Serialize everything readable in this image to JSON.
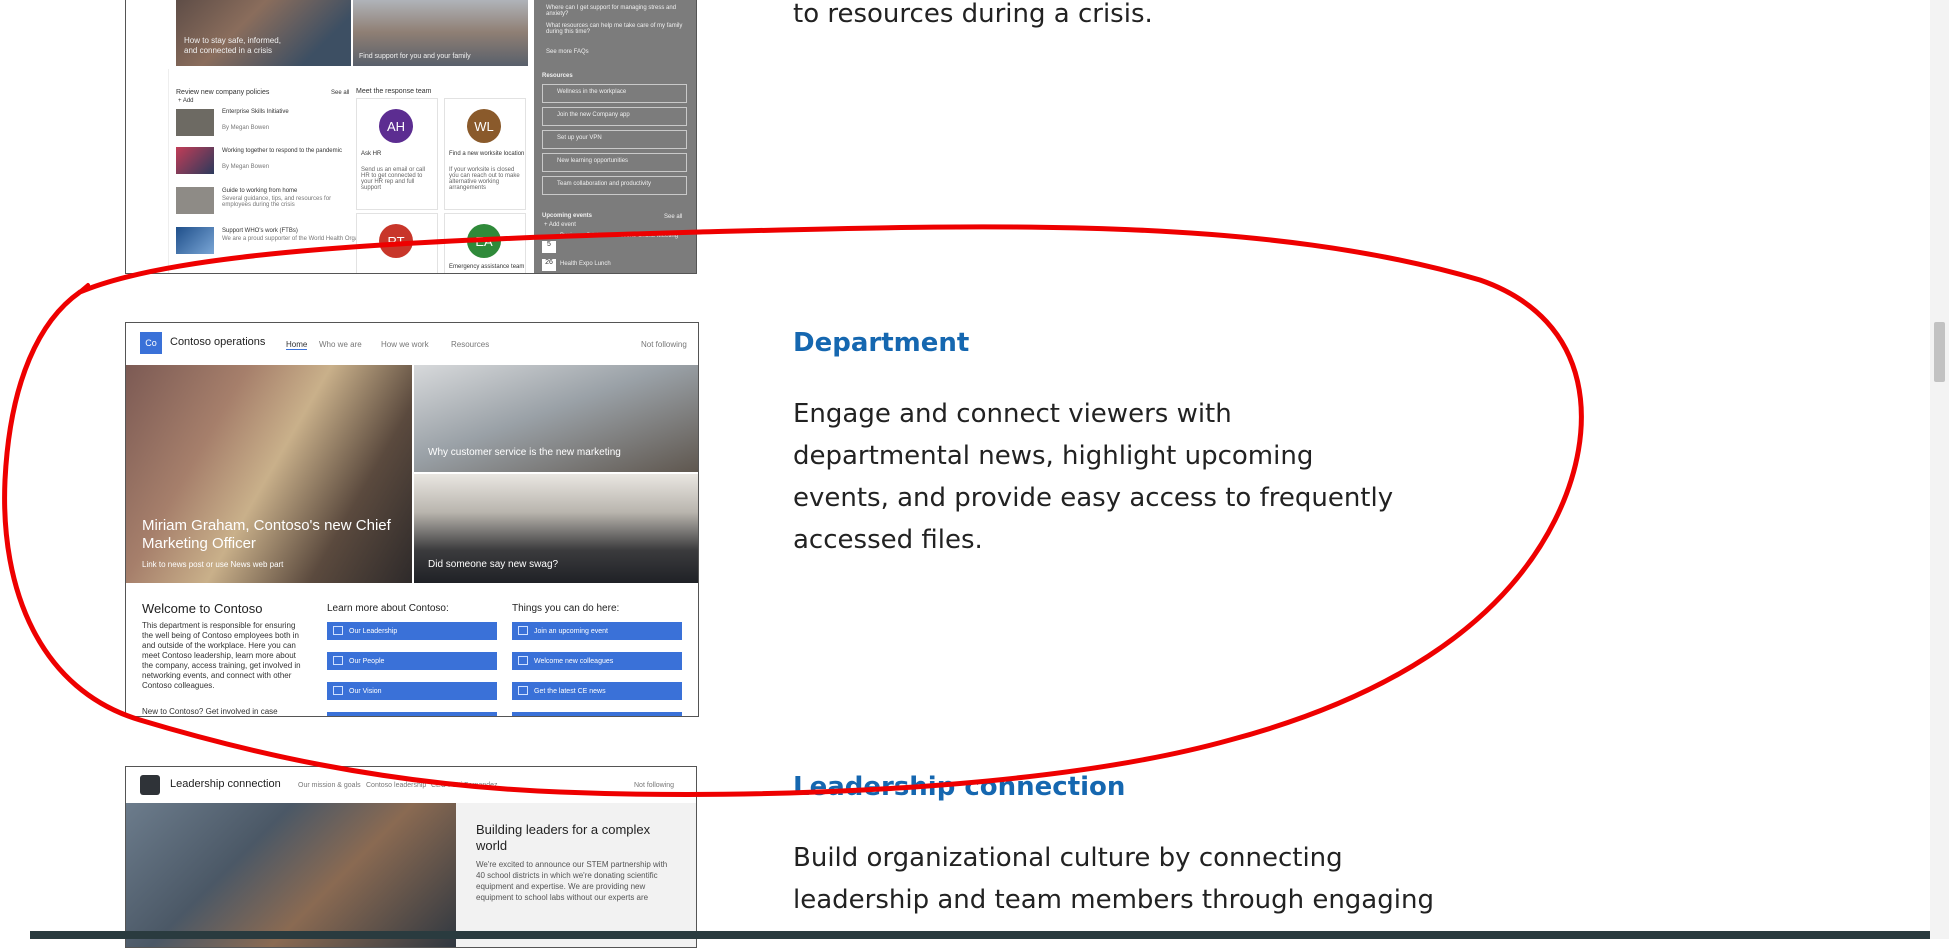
{
  "crisis_section": {
    "description_tail": "to resources during a crisis.",
    "thumb": {
      "hero_left_caption": "How to stay safe, informed, and connected in a crisis",
      "hero_right_caption": "Find support for you and your family",
      "policies_heading": "Review new company policies",
      "see_all": "See all",
      "add": "+ Add",
      "news_items": [
        {
          "title": "Enterprise Skills Initiative",
          "meta": "By Megan Bowen"
        },
        {
          "title": "Working together to respond to the pandemic",
          "meta": "By Megan Bowen"
        },
        {
          "title": "Guide to working from home",
          "meta": "Several guidance, tips, and resources for employees during the crisis"
        },
        {
          "title": "Support WHO's work (FTBs)",
          "meta": "We are a proud supporter of the World Health Organization's"
        }
      ],
      "team_heading": "Meet the response team",
      "team_cards": [
        {
          "initials": "AH",
          "title": "Ask HR",
          "text": "Send us an email or call HR to get connected to your HR rep and full support",
          "color": "#5c2d91"
        },
        {
          "initials": "WL",
          "title": "Find a new worksite location",
          "text": "If your worksite is closed you can reach out to make alternative working arrangements",
          "color": "#8a5a2b"
        },
        {
          "initials": "RT",
          "title": "",
          "text": "",
          "color": "#c8362a"
        },
        {
          "initials": "EA",
          "title": "Emergency assistance team",
          "text": "",
          "color": "#2f8a3a"
        }
      ],
      "sidebar_top_items": [
        "Where can I get support for managing stress and anxiety?",
        "What resources can help me take care of my family during this time?",
        "See more FAQs"
      ],
      "resources_heading": "Resources",
      "resources": [
        "Wellness in the workplace",
        "Join the new Company app",
        "Set up your VPN",
        "New learning opportunities",
        "Team collaboration and productivity"
      ],
      "events_heading": "Upcoming events",
      "events_see_all": "See all",
      "events_add": "+ Add event",
      "event_days": [
        "5",
        "26"
      ],
      "event_names": [
        "Business Crisis Connections Online Meeting",
        "Health Expo Lunch"
      ]
    }
  },
  "department_section": {
    "title": "Department",
    "description": "Engage and connect viewers with departmental news, highlight upcoming events, and provide easy access to frequently accessed files.",
    "thumb": {
      "logo_initials": "Co",
      "site_name": "Contoso operations",
      "nav": [
        "Home",
        "Who we are",
        "How we work",
        "Resources"
      ],
      "follow": "Not following",
      "hero_main_caption_line1": "Miriam Graham, Contoso's new Chief",
      "hero_main_caption_line2": "Marketing Officer",
      "hero_main_sub": "Link to news post or use News web part",
      "hero_tr_caption": "Why customer service is the new marketing",
      "hero_br_caption": "Did someone say new swag?",
      "welcome_heading": "Welcome to Contoso",
      "welcome_text": "This department is responsible for ensuring the well being of Contoso employees both in and outside of the workplace. Here you can meet Contoso leadership, learn more about the company, access training, get involved in networking events, and connect with other Contoso colleagues.",
      "welcome_more": "New to Contoso? Get involved in case",
      "learn_heading": "Learn more about Contoso:",
      "learn_buttons": [
        "Our Leadership",
        "Our People",
        "Our Vision"
      ],
      "things_heading": "Things you can do here:",
      "things_buttons": [
        "Join an upcoming event",
        "Welcome new colleagues",
        "Get the latest CE news"
      ]
    }
  },
  "leadership_section": {
    "title": "Leadership connection",
    "description_line1": "Build organizational culture by connecting",
    "description_line2": "leadership and team members through engaging",
    "thumb": {
      "site_name": "Leadership connection",
      "nav": [
        "Our mission & goals",
        "Contoso leadership",
        "CEO Patti Fernandez"
      ],
      "follow": "Not following",
      "feature_title": "Building leaders for a complex world",
      "feature_text": "We're excited to announce our STEM partnership with 40 school districts in which we're donating scientific equipment and expertise. We are providing new equipment to school labs without our experts are"
    }
  },
  "annotation": {
    "color": "#ee0000",
    "shape": "hand-drawn-loop"
  }
}
